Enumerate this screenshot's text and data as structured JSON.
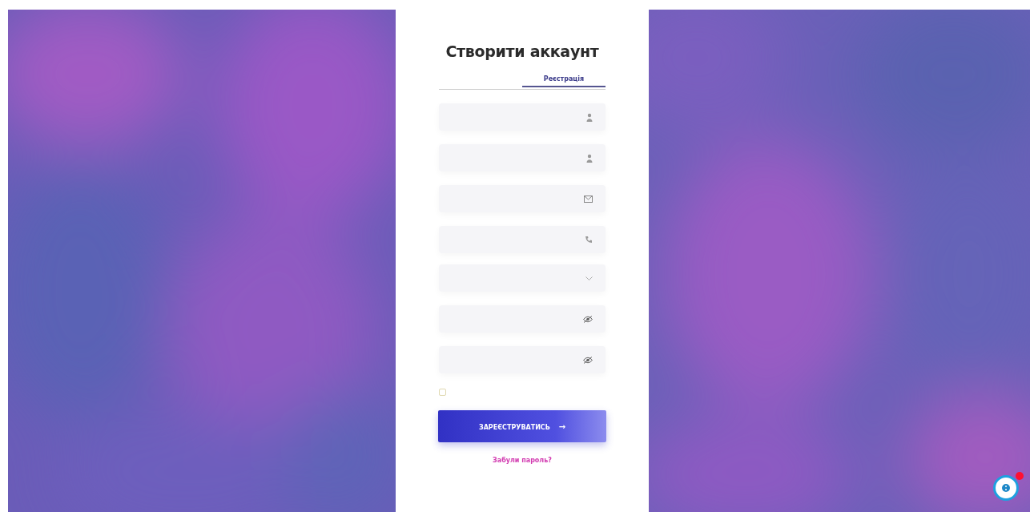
{
  "form": {
    "title": "Створити аккаунт",
    "tabs": [
      {
        "label": "Реєстрація",
        "selected": true
      }
    ],
    "fields": [
      {
        "kind": "name"
      },
      {
        "kind": "name"
      },
      {
        "kind": "email"
      },
      {
        "kind": "phone"
      },
      {
        "kind": "select"
      },
      {
        "kind": "password"
      },
      {
        "kind": "password"
      }
    ],
    "consent": {
      "checked": false
    },
    "submit": {
      "label": "ЗАРЕЄСТРУВАТИСЬ",
      "arrow": "→"
    },
    "link": "Забули пароль?"
  },
  "chat": {
    "unread": true
  }
}
